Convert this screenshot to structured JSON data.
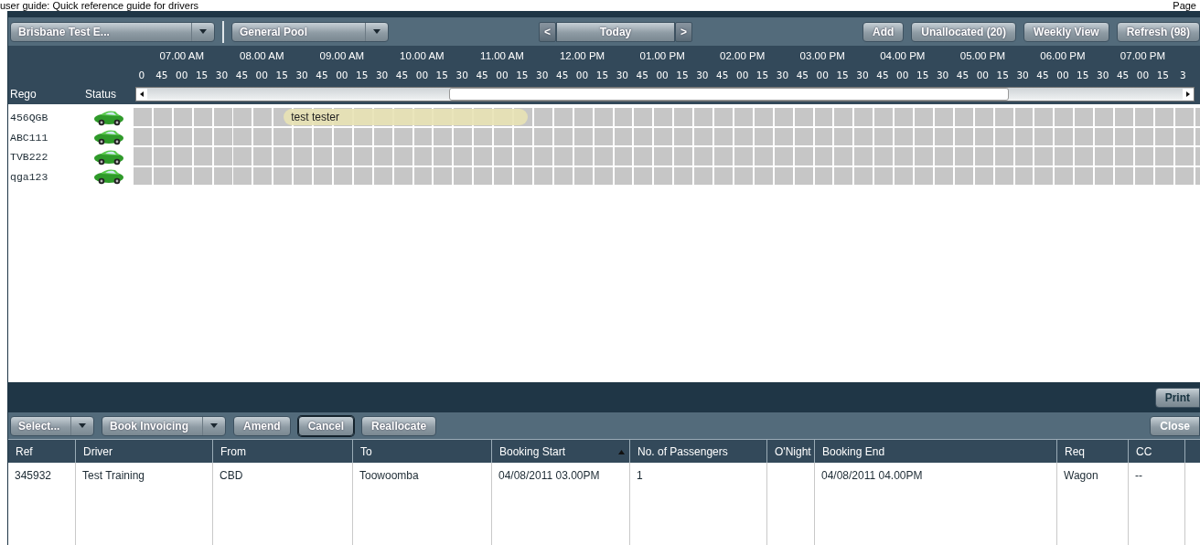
{
  "document": {
    "title": "user guide: Quick reference guide for drivers",
    "page": "Page"
  },
  "toolbar": {
    "location": {
      "value": "Brisbane Test E..."
    },
    "pool": {
      "value": "General Pool"
    },
    "nav": {
      "prev": "<",
      "label": "Today",
      "next": ">"
    },
    "buttons": [
      "Add",
      "Unallocated (20)",
      "Weekly View",
      "Refresh (98)"
    ]
  },
  "timeline": {
    "rego_label": "Rego",
    "status_label": "Status",
    "hours": [
      "07.00 AM",
      "08.00 AM",
      "09.00 AM",
      "10.00 AM",
      "11.00 AM",
      "12.00 PM",
      "01.00 PM",
      "02.00 PM",
      "03.00 PM",
      "04.00 PM",
      "05.00 PM",
      "06.00 PM",
      "07.00 PM"
    ],
    "minutes": [
      "0",
      "45",
      "00",
      "15",
      "30",
      "45",
      "00",
      "15",
      "30",
      "45",
      "00",
      "15",
      "30",
      "45",
      "00",
      "15",
      "30",
      "45",
      "00",
      "15",
      "30",
      "45",
      "00",
      "15",
      "30",
      "45",
      "00",
      "15",
      "30",
      "45",
      "00",
      "15",
      "30",
      "45",
      "00",
      "15",
      "30",
      "45",
      "00",
      "15",
      "30",
      "45",
      "00",
      "15",
      "30",
      "45",
      "00",
      "15",
      "30",
      "45",
      "00",
      "15",
      "3"
    ]
  },
  "vehicles": [
    {
      "rego": "456QGB",
      "booking": "test tester"
    },
    {
      "rego": "ABC111"
    },
    {
      "rego": "TVB222"
    },
    {
      "rego": "qga123"
    }
  ],
  "print_button": "Print",
  "actions": [
    {
      "kind": "dropdown",
      "label": "Select...",
      "focused": false
    },
    {
      "kind": "dropdown",
      "label": "Book Invoicing",
      "focused": false
    },
    {
      "kind": "button",
      "label": "Amend",
      "focused": false
    },
    {
      "kind": "button",
      "label": "Cancel",
      "focused": true
    },
    {
      "kind": "button",
      "label": "Reallocate",
      "focused": false
    }
  ],
  "close_button": "Close",
  "table": {
    "columns": [
      {
        "label": "Ref",
        "sorted": false
      },
      {
        "label": "Driver",
        "sorted": false
      },
      {
        "label": "From",
        "sorted": false
      },
      {
        "label": "To",
        "sorted": false
      },
      {
        "label": "Booking Start",
        "sorted": true
      },
      {
        "label": "No. of Passengers",
        "sorted": false
      },
      {
        "label": "O'Night",
        "sorted": false
      },
      {
        "label": "Booking End",
        "sorted": false
      },
      {
        "label": "Req",
        "sorted": false
      },
      {
        "label": "CC",
        "sorted": false
      }
    ],
    "rows": [
      [
        "345932",
        "Test Training",
        "CBD",
        "Toowoomba",
        "04/08/2011 03.00PM",
        "1",
        "",
        "04/08/2011 04.00PM",
        "Wagon",
        "--"
      ]
    ]
  }
}
